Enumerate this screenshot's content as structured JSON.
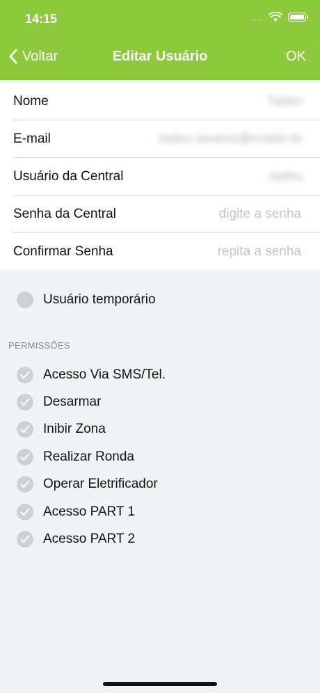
{
  "status_bar": {
    "time": "14:15",
    "signal_dots": "....",
    "wifi_icon": "wifi-icon",
    "battery_icon": "battery-icon"
  },
  "nav": {
    "back_label": "Voltar",
    "title": "Editar Usuário",
    "ok_label": "OK"
  },
  "colors": {
    "header_bg": "#8cca3c",
    "background": "#f1f4f7",
    "checkbox": "#cfd0d2"
  },
  "form": {
    "nome_label": "Nome",
    "nome_value": "Tadeu",
    "email_label": "E-mail",
    "email_value": "tadeu.tavares@mailer.br",
    "usuario_label": "Usuário da Central",
    "usuario_value": "tadeu",
    "senha_label": "Senha da Central",
    "senha_placeholder": "digite a senha",
    "confirmar_label": "Confirmar Senha",
    "confirmar_placeholder": "repita a senha"
  },
  "temporary_user_label": "Usuário temporário",
  "permissions": {
    "header": "PERMISSÕES",
    "items": [
      "Acesso Via SMS/Tel.",
      "Desarmar",
      "Inibir Zona",
      "Realizar Ronda",
      "Operar Eletrificador",
      "Acesso PART 1",
      "Acesso PART 2"
    ]
  }
}
